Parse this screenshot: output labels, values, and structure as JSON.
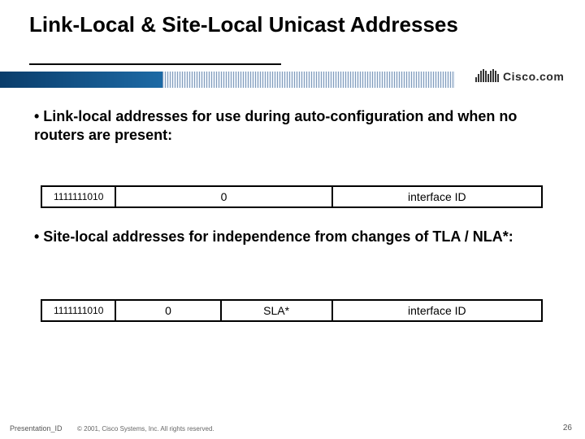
{
  "title": "Link-Local & Site-Local Unicast Addresses",
  "logo_text": "Cisco.com",
  "bullets": {
    "first": "• Link-local addresses for use during auto-configuration and when no routers are present:",
    "second": "• Site-local addresses for independence from changes of TLA / NLA*:"
  },
  "diagram1": {
    "prefix": "1111111010",
    "mid": "0",
    "iid": "interface ID"
  },
  "diagram2": {
    "prefix": "1111111010",
    "zero": "0",
    "sla": "SLA*",
    "iid": "interface ID"
  },
  "footer": {
    "presentation_id": "Presentation_ID",
    "copyright": "© 2001, Cisco Systems, Inc. All rights reserved.",
    "page": "26"
  }
}
